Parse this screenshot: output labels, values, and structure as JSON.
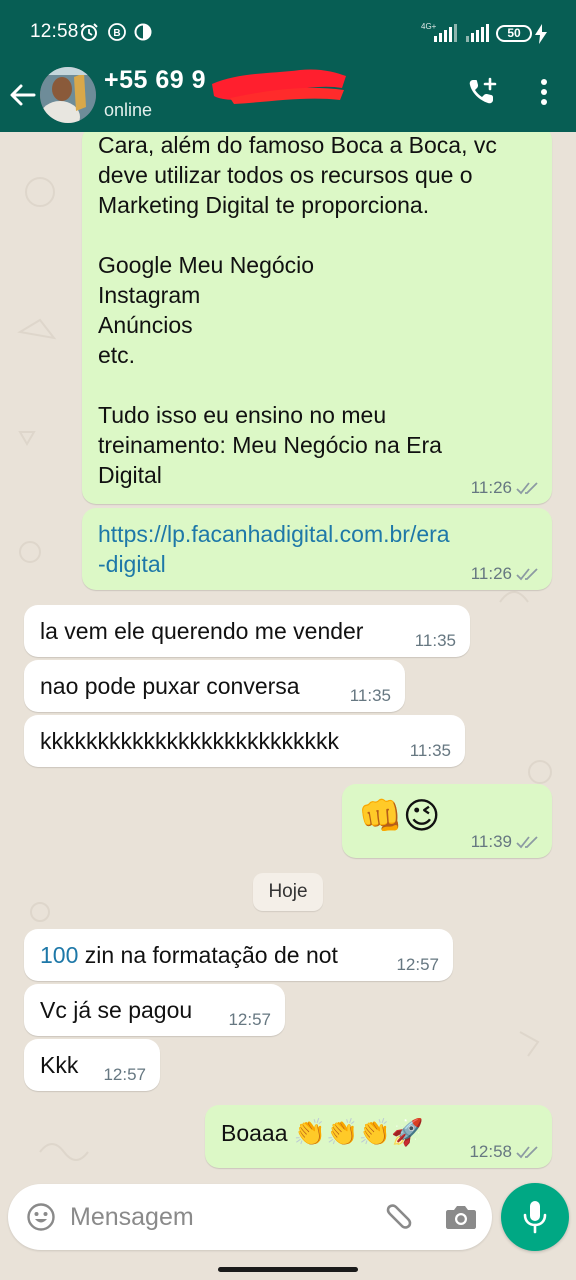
{
  "status_bar": {
    "time": "12:58",
    "network": "4G+",
    "battery": "50",
    "icons": [
      "alarm-icon",
      "b-icon",
      "half-moon-icon",
      "signal-icon",
      "battery-icon",
      "charging-icon"
    ]
  },
  "header": {
    "contact_name": "+55 69 9",
    "status": "online",
    "icons": [
      "back-arrow-icon",
      "avatar",
      "add-call-icon",
      "more-vert-icon"
    ]
  },
  "messages": [
    {
      "dir": "out",
      "text": "Cara, além do famoso Boca a Boca, vc\ndeve utilizar todos os recursos que o\nMarketing Digital te proporciona.\n\nGoogle Meu Negócio\nInstagram\nAnúncios\netc.\n\nTudo isso eu ensino no meu\ntreinamento: Meu Negócio na Era\nDigital",
      "time": "11:26"
    },
    {
      "dir": "out",
      "text": "https://lp.facanhadigital.com.br/era\n-digital",
      "time": "11:26"
    },
    {
      "dir": "in",
      "text": "la vem ele querendo me vender",
      "time": "11:35"
    },
    {
      "dir": "in",
      "text": "nao pode puxar conversa",
      "time": "11:35"
    },
    {
      "dir": "in",
      "text": "kkkkkkkkkkkkkkkkkkkkkkkkkk",
      "time": "11:35"
    },
    {
      "dir": "out",
      "text": "👊😉",
      "time": "11:39"
    },
    {
      "dir": "in",
      "num": "100",
      "text": " zin na formatação de not",
      "time": "12:57"
    },
    {
      "dir": "in",
      "text": "Vc já se pagou",
      "time": "12:57"
    },
    {
      "dir": "in",
      "text": "Kkk",
      "time": "12:57"
    },
    {
      "dir": "out",
      "text": "Boaaa",
      "emoji": "👏👏👏🚀",
      "time": "12:58"
    }
  ],
  "date_divider": "Hoje",
  "composer": {
    "placeholder": "Mensagem",
    "icons": [
      "emoji-icon",
      "attach-icon",
      "camera-icon",
      "mic-icon"
    ]
  },
  "colors": {
    "header": "#075e54",
    "outgoing_bubble": "#dcf8c6",
    "incoming_bubble": "#ffffff",
    "chat_background": "#e9e2d8",
    "accent": "#00a884",
    "link": "#1e78a8",
    "tick": "#8c9aa3"
  }
}
